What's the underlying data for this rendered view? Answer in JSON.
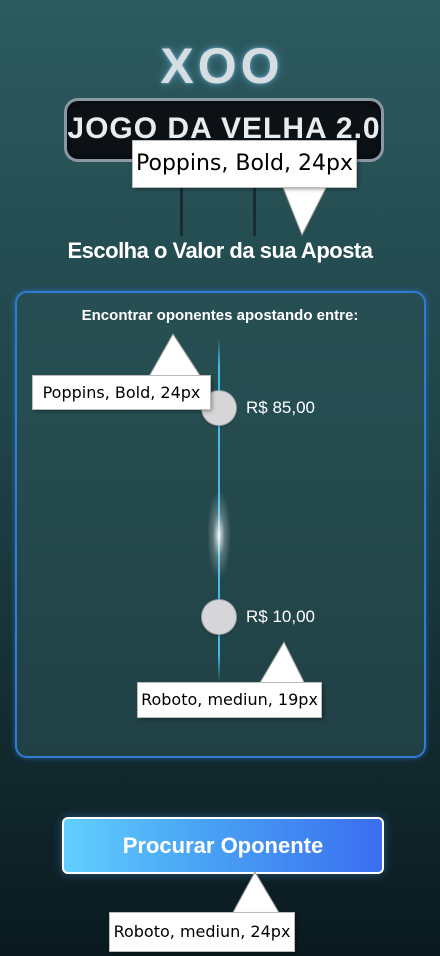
{
  "logo": {
    "mark": "XOO",
    "title": "JOGO DA VELHA 2.0"
  },
  "heading": "Escolha o Valor da sua Aposta",
  "panel": {
    "label": "Encontrar oponentes apostando entre:",
    "range_max": "R$ 85,00",
    "range_min": "R$ 10,00",
    "range_min_value": 10.0,
    "range_max_value": 85.0
  },
  "button": {
    "label": "Procurar Oponente"
  },
  "annotations": {
    "heading_font": "Poppins, Bold, 24px",
    "panel_label_font": "Poppins, Bold, 24px",
    "value_font": "Roboto, mediun, 19px",
    "button_font": "Roboto, mediun, 24px"
  },
  "colors": {
    "accent_blue": "#2f7bd6",
    "slider_track": "#41bde8",
    "button_gradient_start": "#62cfff",
    "button_gradient_end": "#3a6ef0"
  }
}
